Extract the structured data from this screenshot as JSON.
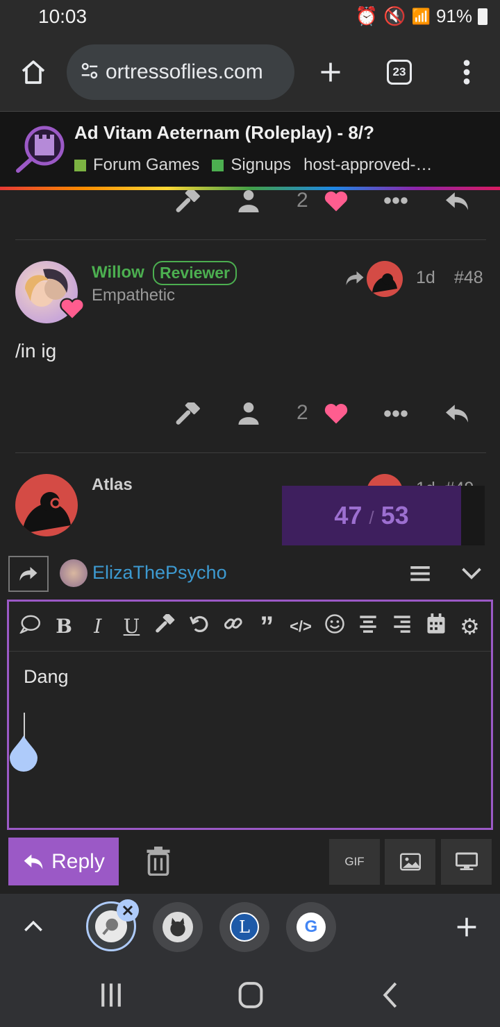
{
  "status_bar": {
    "time": "10:03",
    "battery": "91%"
  },
  "browser": {
    "url": "ortressoflies.com",
    "tab_count": "23"
  },
  "topic": {
    "title": "Ad Vitam Aeternam (Roleplay) - 8/?",
    "tags": [
      {
        "label": "Forum Games",
        "color": "#7cb342"
      },
      {
        "label": "Signups",
        "color": "#4caf50"
      },
      {
        "label": "host-approved-…",
        "color": ""
      }
    ]
  },
  "colors": {
    "accent": "#9b59c6",
    "like": "#ff5d8f",
    "username_green": "#4caf50",
    "username_blue": "#3d9ad1"
  },
  "post_prev": {
    "likes": "2"
  },
  "post_48": {
    "username": "Willow",
    "badge": "Reviewer",
    "title": "Empathetic",
    "time": "1d",
    "number": "#48",
    "body": "/in ig",
    "likes": "2"
  },
  "post_49": {
    "username": "Atlas",
    "time": "1d",
    "number": "#49"
  },
  "progress": {
    "current": "47",
    "separator": "/",
    "total": "53"
  },
  "composer": {
    "reply_to": "ElizaThePsycho",
    "text": "Dang",
    "reply_label": "Reply",
    "gif_label": "GIF"
  }
}
